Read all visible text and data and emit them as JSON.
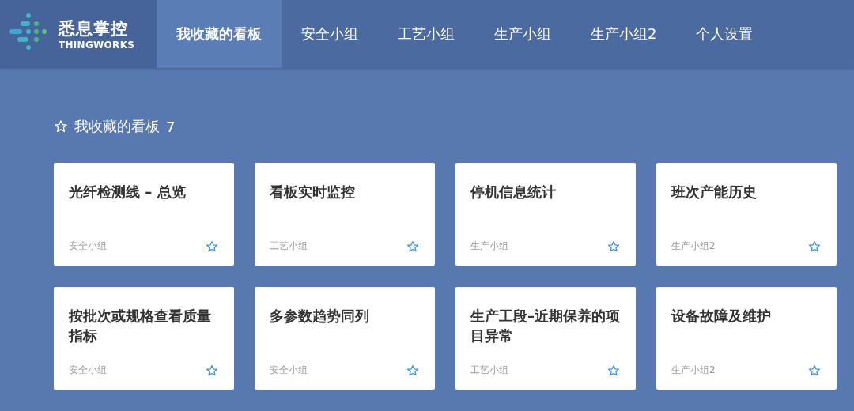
{
  "brand": {
    "name": "悉息掌控",
    "subtitle": "THINGWORKS"
  },
  "tabs": [
    {
      "label": "我收藏的看板",
      "selected": true
    },
    {
      "label": "安全小组",
      "selected": false
    },
    {
      "label": "工艺小组",
      "selected": false
    },
    {
      "label": "生产小组",
      "selected": false
    },
    {
      "label": "生产小组2",
      "selected": false
    },
    {
      "label": "个人设置",
      "selected": false
    }
  ],
  "section": {
    "title": "我收藏的看板",
    "count": "7"
  },
  "boards": [
    {
      "title": "光纤检测线 – 总览",
      "group": "安全小组"
    },
    {
      "title": "看板实时监控",
      "group": "工艺小组"
    },
    {
      "title": "停机信息统计",
      "group": "生产小组"
    },
    {
      "title": "班次产能历史",
      "group": "生产小组2"
    },
    {
      "title": "按批次或规格查看质量指标",
      "group": "安全小组"
    },
    {
      "title": "多参数趋势同列",
      "group": "安全小组"
    },
    {
      "title": "生产工段–近期保养的项目异常",
      "group": "工艺小组"
    },
    {
      "title": "设备故障及维护",
      "group": "生产小组2"
    }
  ]
}
